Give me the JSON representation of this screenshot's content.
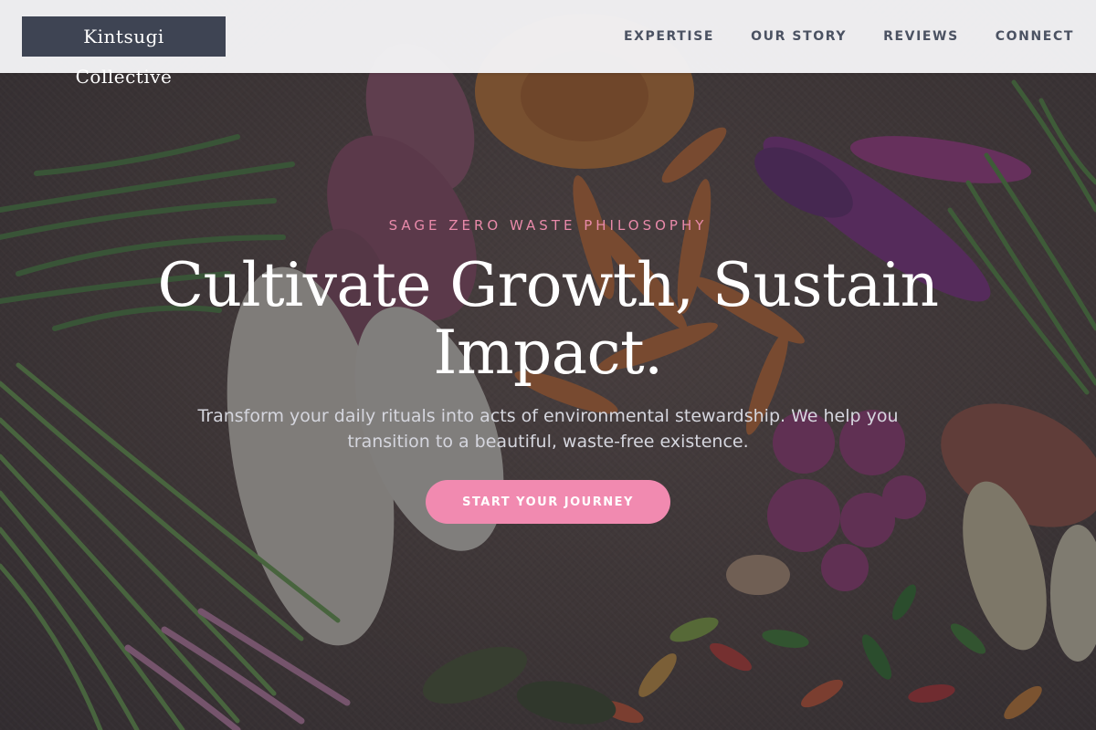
{
  "header": {
    "logo_text": "Kintsugi Collective",
    "nav": [
      {
        "label": "EXPERTISE"
      },
      {
        "label": "OUR STORY"
      },
      {
        "label": "REVIEWS"
      },
      {
        "label": "CONNECT"
      }
    ]
  },
  "hero": {
    "eyebrow": "SAGE ZERO WASTE PHILOSOPHY",
    "headline_line1": "Cultivate Growth, Sustain",
    "headline_line2": "Impact.",
    "subtext": "Transform your daily rituals into acts of environmental stewardship. We help you transition to a beautiful, waste-free existence.",
    "cta_label": "START YOUR JOURNEY"
  },
  "colors": {
    "accent_pink": "#f18ab0",
    "logo_bg": "#3e4453",
    "nav_text": "#4b5262"
  }
}
